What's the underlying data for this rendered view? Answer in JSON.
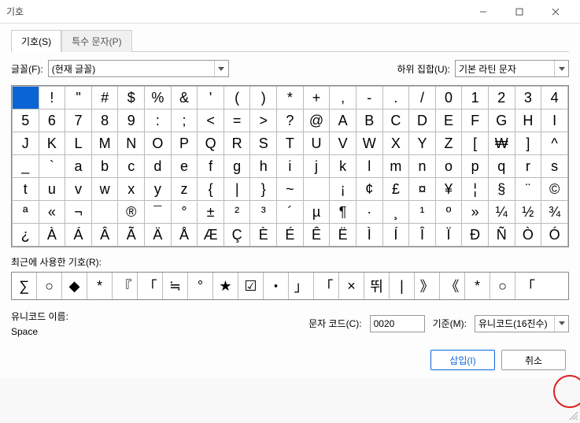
{
  "window": {
    "title": "기호"
  },
  "tabs": {
    "symbols": "기호(S)",
    "special": "특수 문자(P)"
  },
  "font": {
    "label": "글꼴(F):",
    "value": "(현재 글꼴)"
  },
  "subset": {
    "label": "하위 집합(U):",
    "value": "기본 라틴 문자"
  },
  "recent": {
    "label": "최근에 사용한 기호(R):"
  },
  "unicode": {
    "label": "유니코드 이름:",
    "name": "Space"
  },
  "code": {
    "label": "문자 코드(C):",
    "value": "0020"
  },
  "standard": {
    "label": "기준(M):",
    "value": "유니코드(16진수)"
  },
  "buttons": {
    "insert": "삽입(I)",
    "cancel": "취소"
  },
  "chart_data": {
    "type": "table",
    "title": "Character grid",
    "rows": [
      [
        "",
        "!",
        "\"",
        "#",
        "$",
        "%",
        "&",
        "'",
        "(",
        ")",
        "*",
        "+",
        ",",
        "-",
        ".",
        "/",
        "0",
        "1",
        "2",
        "3",
        "4"
      ],
      [
        "5",
        "6",
        "7",
        "8",
        "9",
        ":",
        ";",
        "<",
        "=",
        ">",
        "?",
        "@",
        "A",
        "B",
        "C",
        "D",
        "E",
        "F",
        "G",
        "H",
        "I"
      ],
      [
        "J",
        "K",
        "L",
        "M",
        "N",
        "O",
        "P",
        "Q",
        "R",
        "S",
        "T",
        "U",
        "V",
        "W",
        "X",
        "Y",
        "Z",
        "[",
        "₩",
        "]",
        "^"
      ],
      [
        "_",
        "`",
        "a",
        "b",
        "c",
        "d",
        "e",
        "f",
        "g",
        "h",
        "i",
        "j",
        "k",
        "l",
        "m",
        "n",
        "o",
        "p",
        "q",
        "r",
        "s"
      ],
      [
        "t",
        "u",
        "v",
        "w",
        "x",
        "y",
        "z",
        "{",
        "|",
        "}",
        "~",
        "",
        "¡",
        "¢",
        "£",
        "¤",
        "¥",
        "¦",
        "§",
        "¨",
        "©"
      ],
      [
        "ª",
        "«",
        "¬",
        "­",
        "®",
        "¯",
        "°",
        "±",
        "²",
        "³",
        "´",
        "µ",
        "¶",
        "·",
        "¸",
        "¹",
        "º",
        "»",
        "¼",
        "½",
        "¾"
      ],
      [
        "¿",
        "À",
        "Á",
        "Â",
        "Ã",
        "Ä",
        "Å",
        "Æ",
        "Ç",
        "È",
        "É",
        "Ê",
        "Ë",
        "Ì",
        "Í",
        "Î",
        "Ï",
        "Ð",
        "Ñ",
        "Ò",
        "Ó"
      ]
    ],
    "selected": {
      "row": 0,
      "col": 0
    }
  },
  "recent_chars": [
    "∑",
    "○",
    "◆",
    "*",
    "『",
    "「",
    "≒",
    "°",
    "★",
    "☑",
    "・",
    "」",
    "「",
    "×",
    "뛰",
    "|",
    "》",
    "《",
    "*",
    "○",
    "「"
  ]
}
